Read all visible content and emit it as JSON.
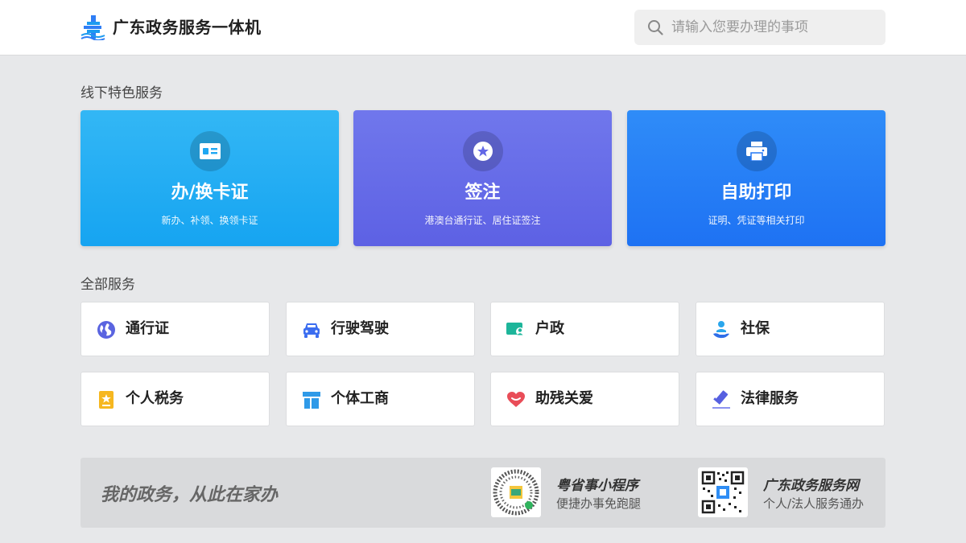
{
  "header": {
    "title": "广东政务服务一体机",
    "search_placeholder": "请输入您要办理的事项",
    "search_value": ""
  },
  "featured": {
    "section_title": "线下特色服务",
    "cards": [
      {
        "title": "办/换卡证",
        "subtitle": "新办、补领、换领卡证",
        "icon": "id-card-icon",
        "color": "#1aa6f2"
      },
      {
        "title": "签注",
        "subtitle": "港澳台通行证、居住证签注",
        "icon": "star-badge-icon",
        "color": "#6369e7"
      },
      {
        "title": "自助打印",
        "subtitle": "证明、凭证等相关打印",
        "icon": "printer-icon",
        "color": "#2478f5"
      }
    ]
  },
  "services": {
    "section_title": "全部服务",
    "items": [
      {
        "label": "通行证",
        "icon": "globe-icon"
      },
      {
        "label": "行驶驾驶",
        "icon": "car-icon"
      },
      {
        "label": "户政",
        "icon": "household-icon"
      },
      {
        "label": "社保",
        "icon": "social-security-icon"
      },
      {
        "label": "个人税务",
        "icon": "tax-icon"
      },
      {
        "label": "个体工商",
        "icon": "storefront-icon"
      },
      {
        "label": "助残关爱",
        "icon": "heart-icon"
      },
      {
        "label": "法律服务",
        "icon": "gavel-icon"
      }
    ]
  },
  "banner": {
    "slogan": "我的政务，从此在家办",
    "apps": [
      {
        "title": "粤省事小程序",
        "subtitle": "便捷办事免跑腿",
        "icon": "mini-program-qr-icon"
      },
      {
        "title": "广东政务服务网",
        "subtitle": "个人/法人服务通办",
        "icon": "website-qr-icon"
      }
    ]
  }
}
